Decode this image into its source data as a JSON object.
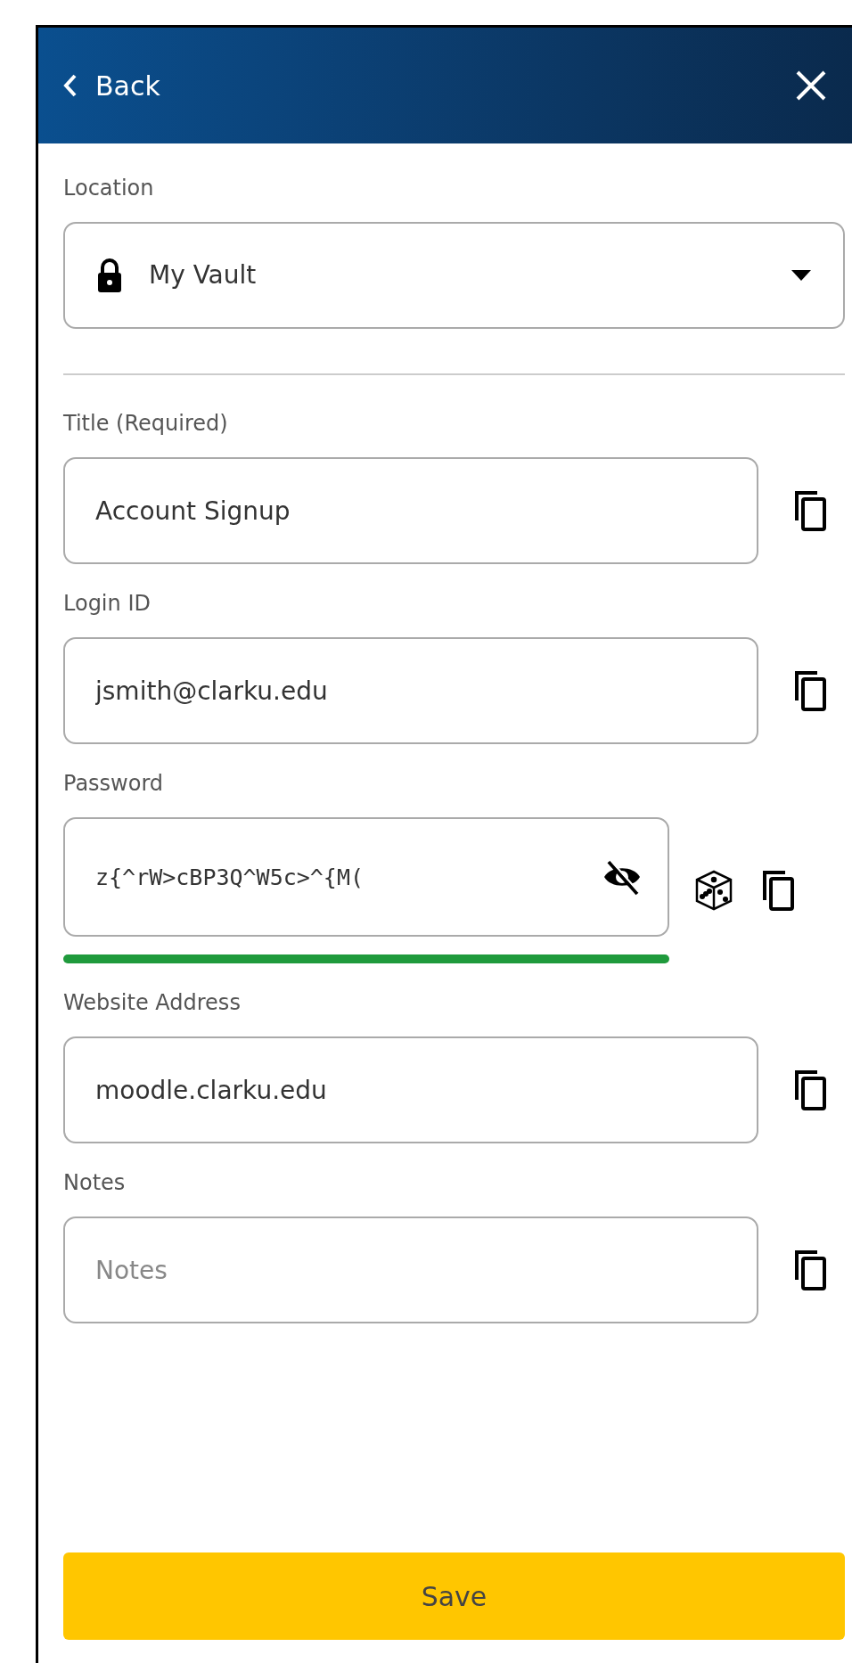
{
  "header": {
    "back": "Back"
  },
  "location": {
    "label": "Location",
    "value": "My Vault"
  },
  "fields": [
    {
      "kind": "text",
      "label": "Title (Required)",
      "value": "Account Signup"
    },
    {
      "kind": "text",
      "label": "Login ID",
      "value": "jsmith@clarku.edu"
    },
    {
      "kind": "password",
      "label": "Password",
      "value": "z{^rW>cBP3Q^W5c>^{M(",
      "revealed": true
    },
    {
      "kind": "text",
      "label": "Website Address",
      "value": "moodle.clarku.edu"
    },
    {
      "kind": "text",
      "label": "Notes",
      "placeholder": "Notes"
    }
  ],
  "save": "Save"
}
